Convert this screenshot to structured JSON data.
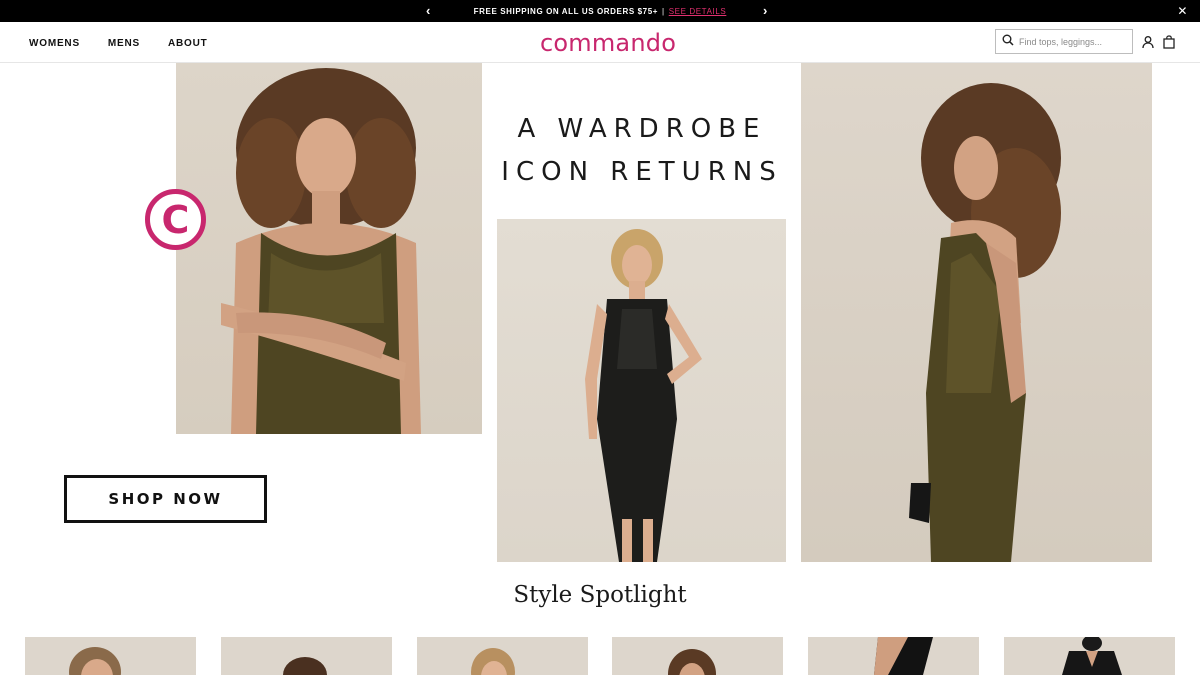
{
  "promo": {
    "text": "FREE SHIPPING ON ALL US ORDERS $75+",
    "separator": "|",
    "link": "SEE DETAILS",
    "prev": "‹",
    "next": "›",
    "close": "✕"
  },
  "header": {
    "nav": [
      "WOMENS",
      "MENS",
      "ABOUT"
    ],
    "logo": "commando",
    "search_placeholder": "Find tops, leggings..."
  },
  "hero": {
    "headline_line1": "A WARDROBE",
    "headline_line2": "ICON RETURNS",
    "brand_mark": "C",
    "cta": "SHOP NOW"
  },
  "spotlight": {
    "title": "Style Spotlight",
    "items": 6
  },
  "colors": {
    "brand": "#c8276e",
    "promo_bg": "#000000",
    "leather": "#4e4522"
  }
}
